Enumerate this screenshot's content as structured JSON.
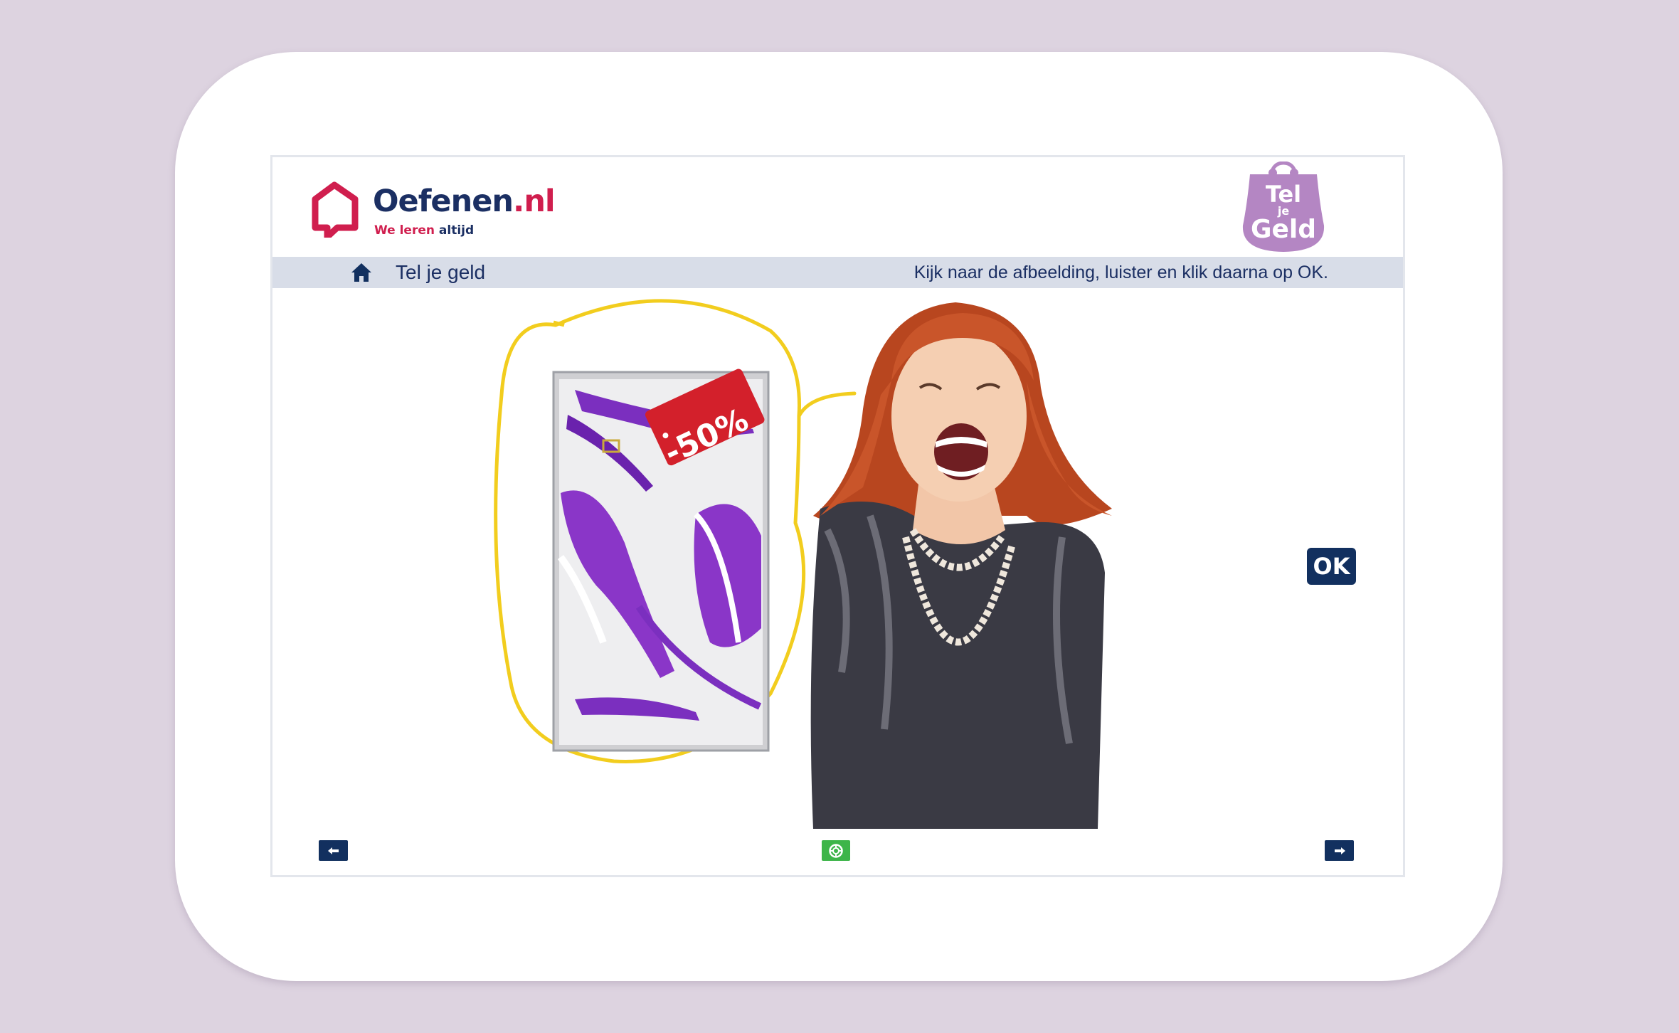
{
  "brand": {
    "name_main": "Oefenen",
    "name_tld": ".nl",
    "tagline_accent": "We leren",
    "tagline_rest": "altijd"
  },
  "module_badge": {
    "line1": "Tel",
    "line2": "je",
    "line3": "Geld"
  },
  "titlebar": {
    "title": "Tel je geld",
    "instruction": "Kijk naar de afbeelding, luister en klik daarna op OK."
  },
  "illustration": {
    "price_tag": "-50%"
  },
  "ok_button": {
    "label": "OK"
  },
  "colors": {
    "navy": "#12305f",
    "brand_red": "#d01e4e",
    "titlebar_bg": "#d8dde8",
    "help_green": "#3db549",
    "badge_purple": "#b486c3",
    "highlight_yellow": "#f2cd1e"
  },
  "icons": {
    "home": "home-icon",
    "prev": "arrow-left-icon",
    "next": "arrow-right-icon",
    "help": "lifebuoy-icon"
  }
}
